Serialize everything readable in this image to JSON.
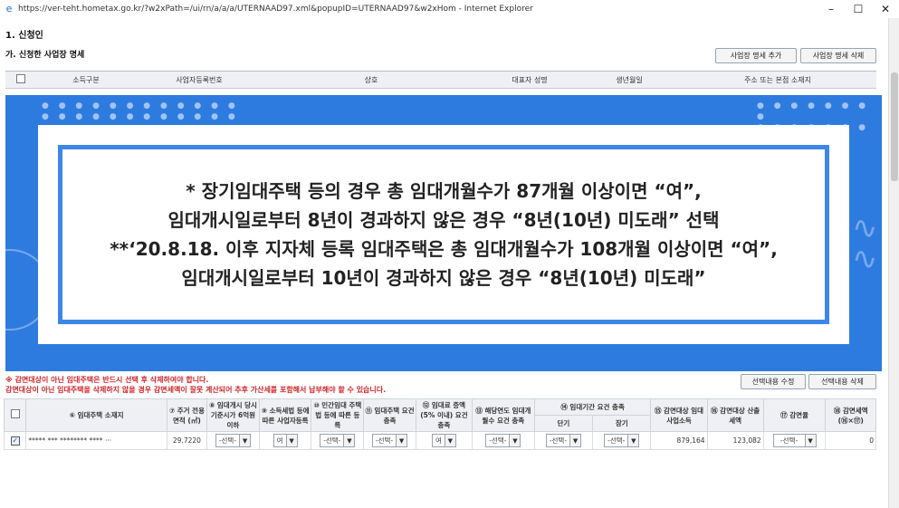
{
  "window": {
    "url": "https://ver-teht.hometax.go.kr/?w2xPath=/ui/rn/a/a/a/UTERNAAD97.xml&popupID=UTERNAAD97&w2xHom - Internet Explorer",
    "minimize": "–",
    "maximize": "☐",
    "close": "✕"
  },
  "page": {
    "section_title": "1. 신청인",
    "sub_title": "가. 신청한 사업장 명세",
    "add_button": "사업장 명세 추가",
    "delete_button": "사업장 명세 삭제"
  },
  "top_table": {
    "headers": [
      "소득구분",
      "사업자등록번호",
      "상호",
      "대표자 성명",
      "생년월일",
      "주소 또는 본점 소재지"
    ]
  },
  "overlay": {
    "lines": [
      "* 장기임대주택 등의 경우 총 임대개월수가 87개월 이상이면 “여”,",
      "임대개시일로부터 8년이 경과하지 않은 경우 “8년(10년) 미도래” 선택",
      "**‘20.8.18. 이후 지자체 등록 임대주택은 총 임대개월수가 108개월 이상이면 “여”,",
      "임대개시일로부터 10년이 경과하지 않은 경우 “8년(10년) 미도래”"
    ]
  },
  "warnings": {
    "line1": "※ 감면대상이 아닌 임대주택은 반드시 선택 후 삭제하여야 합니다.",
    "line2": "감면대상이 아닌 임대주택을 삭제하지 않을 경우 감면세액이 잘못 계산되어 추후 가산세를 포함해서 납부해야 할 수 있습니다."
  },
  "bottom_buttons": {
    "edit": "선택내용 수정",
    "delete": "선택내용 삭제"
  },
  "bottom_table": {
    "headers": {
      "h1": "⑥ 임대주택 소재지",
      "h2": "⑦ 주거 전용 면적 (㎡)",
      "h3": "⑧ 임대개시 당시 기준시가 6억원 이하",
      "h4": "⑨ 소득세법 등에 따른 사업자등록",
      "h5": "⑩ 민간임대 주택법 등에 따른 등록",
      "h6": "⑪ 임대주택 요건 충족",
      "h7": "⑫ 임대료 증액 (5% 이내) 요건 충족",
      "h8": "⑬ 해당연도 임대개월수 요건 충족",
      "h9": "⑭ 임대기간 요건 충족",
      "h9a": "단기",
      "h9b": "장기",
      "h10": "⑮ 감면대상 임대사업소득",
      "h11": "⑯ 감면대상 산출세액",
      "h12": "⑰ 감면율",
      "h13": "⑱ 감면세액 (⑯×⑰)"
    },
    "row": {
      "address": "***** *** ******** **** ···",
      "area": "29.7220",
      "s1": "-선택-",
      "s2": "여",
      "s3": "-선택-",
      "s4": "-선택-",
      "s5": "여",
      "s6": "-선택-",
      "s7": "-선택-",
      "s8": "-선택-",
      "income": "879,164",
      "tax": "123,082",
      "s9": "-선택-",
      "reduction": "0"
    }
  }
}
